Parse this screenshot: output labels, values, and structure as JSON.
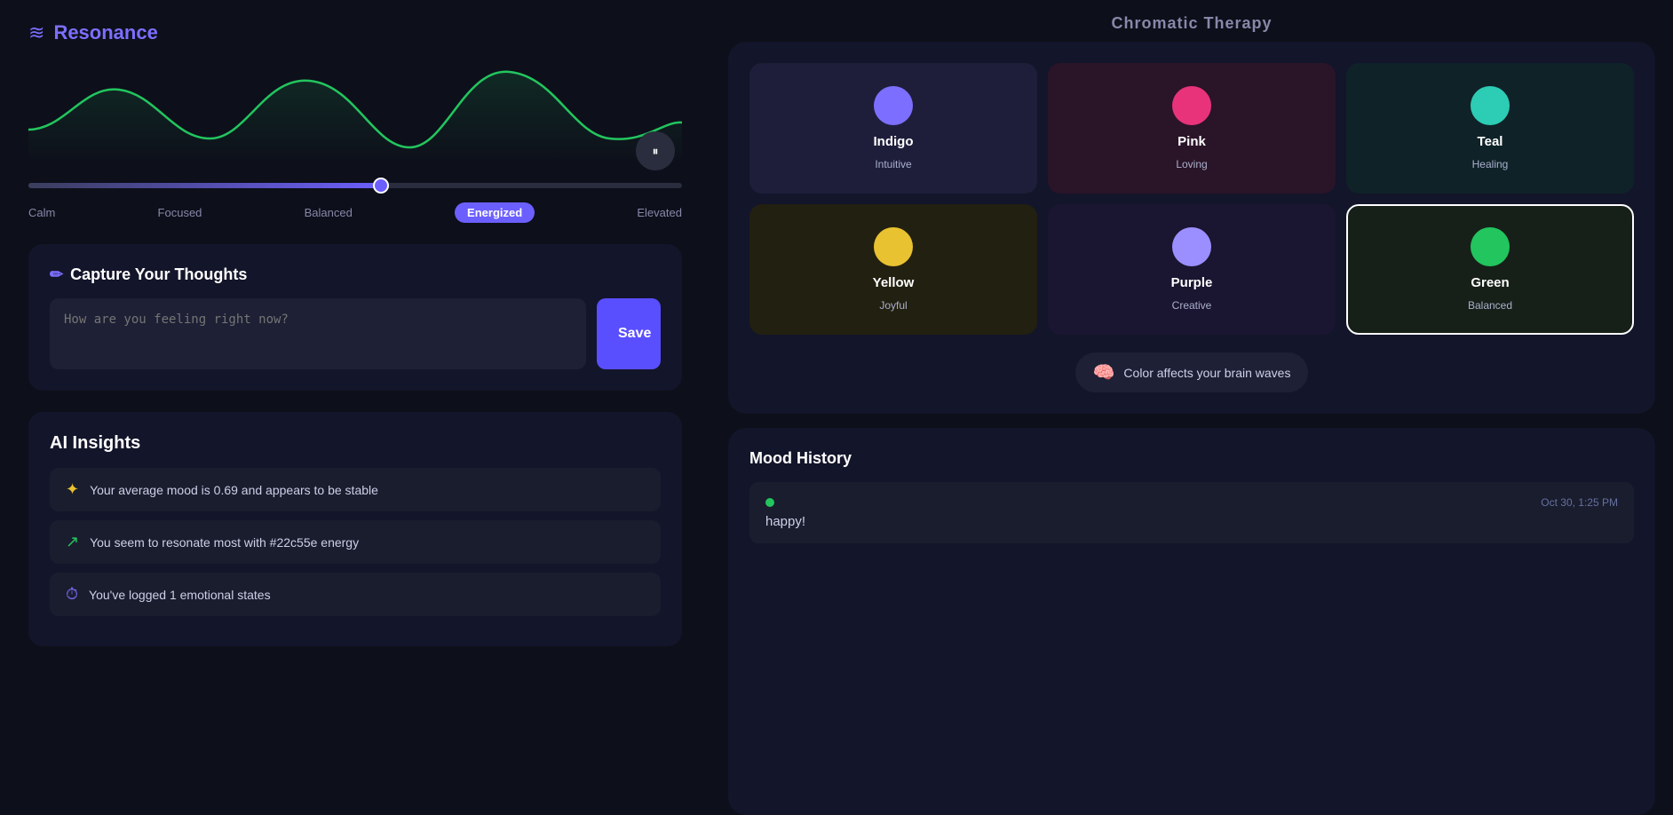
{
  "app": {
    "title": "Resonance",
    "logo_icon": "≋"
  },
  "chromatic": {
    "title": "Chromatic Therapy"
  },
  "mood_slider": {
    "labels": [
      "Calm",
      "Focused",
      "Balanced",
      "Energized",
      "Elevated"
    ],
    "active": "Energized",
    "value": 55
  },
  "capture": {
    "heading": "Capture Your Thoughts",
    "placeholder": "How are you feeling right now?",
    "save_label": "Save"
  },
  "ai_insights": {
    "heading": "AI Insights",
    "insights": [
      {
        "icon": "✦",
        "text": "Your average mood is 0.69 and appears to be stable"
      },
      {
        "icon": "↗",
        "text": "You seem to resonate most with #22c55e energy"
      },
      {
        "icon": "⏱",
        "text": "You've logged 1 emotional states"
      }
    ]
  },
  "colors": [
    {
      "id": "indigo",
      "name": "Indigo",
      "desc": "Intuitive",
      "card_class": "card-indigo",
      "dot_class": "dot-indigo",
      "selected": false
    },
    {
      "id": "pink",
      "name": "Pink",
      "desc": "Loving",
      "card_class": "card-pink",
      "dot_class": "dot-pink",
      "selected": false
    },
    {
      "id": "teal",
      "name": "Teal",
      "desc": "Healing",
      "card_class": "card-teal",
      "dot_class": "dot-teal",
      "selected": false
    },
    {
      "id": "yellow",
      "name": "Yellow",
      "desc": "Joyful",
      "card_class": "card-yellow",
      "dot_class": "dot-yellow",
      "selected": false
    },
    {
      "id": "purple",
      "name": "Purple",
      "desc": "Creative",
      "card_class": "card-purple",
      "dot_class": "dot-purple",
      "selected": false
    },
    {
      "id": "green",
      "name": "Green",
      "desc": "Balanced",
      "card_class": "card-green",
      "dot_class": "dot-green",
      "selected": true
    }
  ],
  "brain_badge": {
    "icon": "🧠",
    "text": "Color affects your brain waves"
  },
  "mood_history": {
    "heading": "Mood History",
    "entries": [
      {
        "dot_color": "#22c55e",
        "timestamp": "Oct 30, 1:25 PM",
        "text": "happy!"
      }
    ]
  }
}
